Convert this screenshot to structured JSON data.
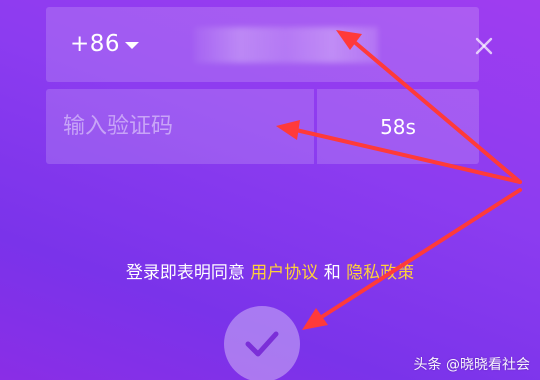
{
  "colors": {
    "background_start": "#9f3df0",
    "background_end": "#7a33ea",
    "link": "#ffcf3a",
    "annotation_arrow": "#ff3a3a"
  },
  "phone": {
    "country_code": "+86",
    "dropdown_icon": "caret-down-icon",
    "value": "",
    "clear_icon": "close-icon"
  },
  "verification": {
    "placeholder": "输入验证码",
    "countdown_label": "58s"
  },
  "agreement": {
    "prefix": "登录即表明同意",
    "user_agreement": "用户协议",
    "conjunction": "和",
    "privacy_policy": "隐私政策"
  },
  "submit": {
    "icon": "checkmark-icon"
  },
  "watermark": {
    "text": "头条 @晓晓看社会"
  }
}
